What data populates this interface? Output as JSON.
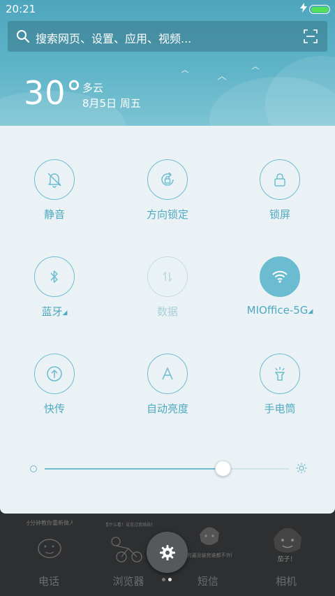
{
  "status_bar": {
    "time": "20:21",
    "battery_level": 1.0
  },
  "search": {
    "placeholder": "搜索网页、设置、应用、视频..."
  },
  "weather": {
    "temperature": "30°",
    "condition": "多云",
    "date": "8月5日 周五"
  },
  "toggles": [
    {
      "label": "静音",
      "icon": "bell-off-icon",
      "state": "off"
    },
    {
      "label": "方向锁定",
      "icon": "rotation-lock-icon",
      "state": "off"
    },
    {
      "label": "锁屏",
      "icon": "lock-icon",
      "state": "off"
    },
    {
      "label": "蓝牙",
      "icon": "bluetooth-icon",
      "state": "off",
      "has_more": true
    },
    {
      "label": "数据",
      "icon": "mobile-data-icon",
      "state": "disabled"
    },
    {
      "label": "MIOffice-5G",
      "icon": "wifi-icon",
      "state": "on",
      "has_more": true
    },
    {
      "label": "快传",
      "icon": "transfer-icon",
      "state": "off"
    },
    {
      "label": "自动亮度",
      "icon": "auto-brightness-icon",
      "state": "off"
    },
    {
      "label": "手电筒",
      "icon": "flashlight-icon",
      "state": "off"
    }
  ],
  "brightness": {
    "level": 0.73
  },
  "dock": {
    "apps": [
      {
        "label": "电话",
        "caption": "分分钟教你重新做人"
      },
      {
        "label": "浏览器",
        "caption": "看什么看！没见过我骑自行车吗"
      },
      {
        "label": "短信",
        "caption": "今天的逼没装完谁都不许睡！"
      },
      {
        "label": "相机",
        "caption": "茄子！"
      }
    ],
    "page_count": 2,
    "active_page": 1
  },
  "colors": {
    "accent": "#6bbcd0",
    "header_top": "#4ea6bd",
    "panel_bg": "#eaf2f5",
    "battery": "#52e05a"
  }
}
